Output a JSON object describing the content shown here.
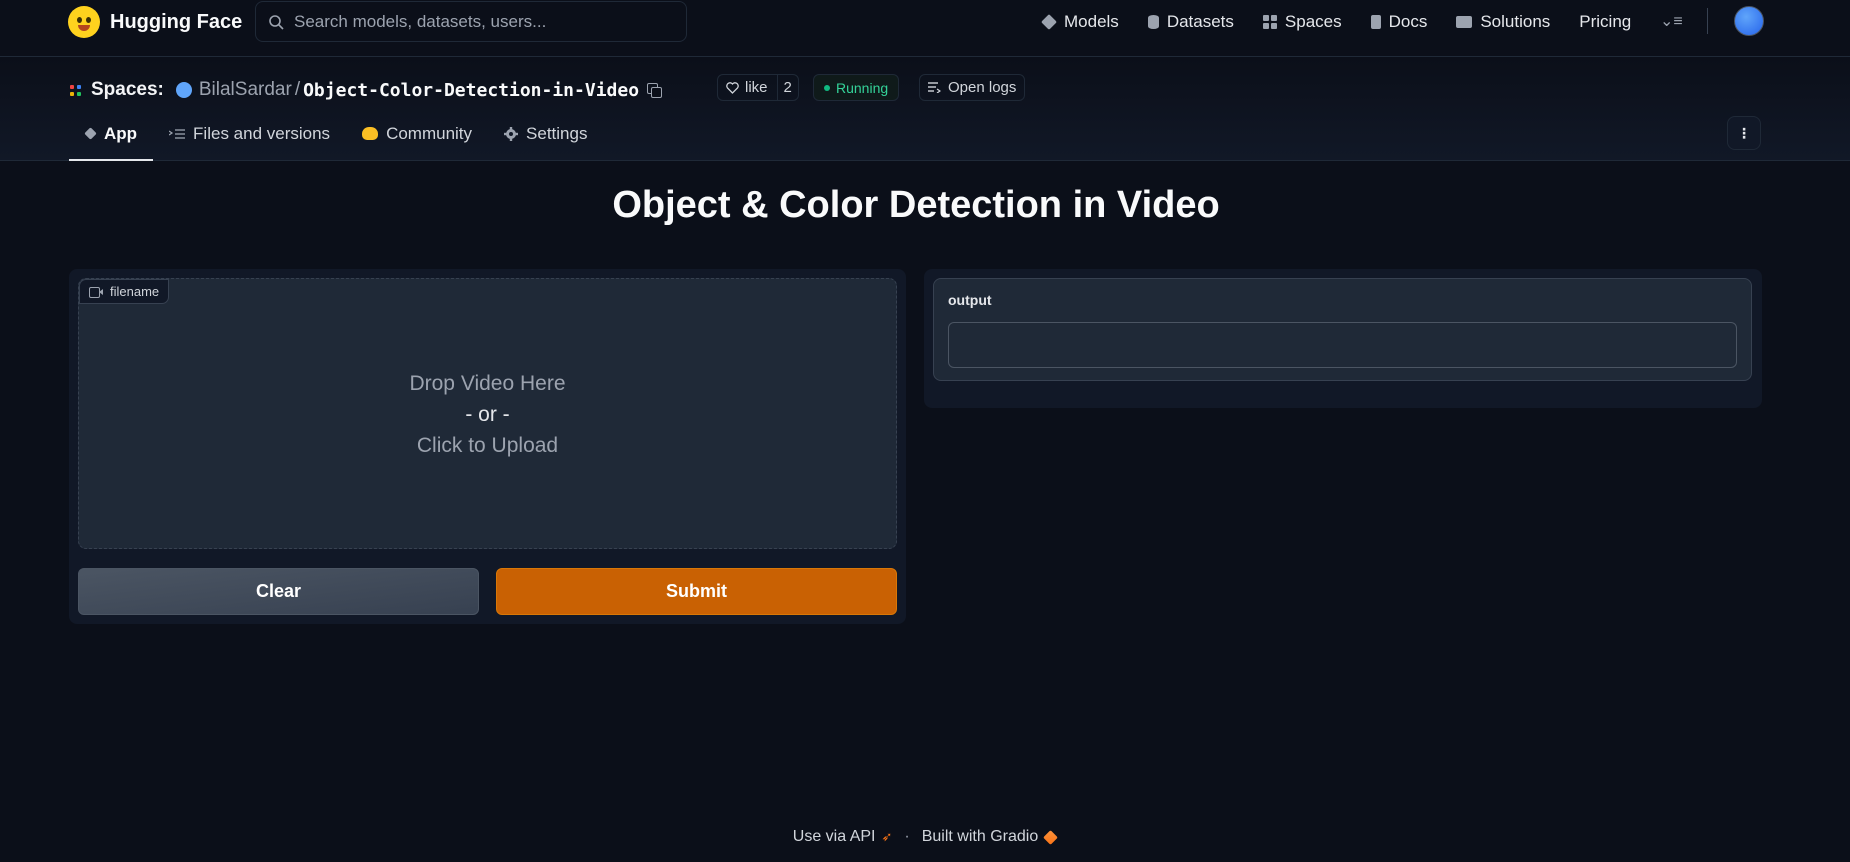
{
  "nav": {
    "brand": "Hugging Face",
    "search_placeholder": "Search models, datasets, users...",
    "links": [
      {
        "label": "Models",
        "icon": "models-cube-icon"
      },
      {
        "label": "Datasets",
        "icon": "database-icon"
      },
      {
        "label": "Spaces",
        "icon": "spaces-grid-icon"
      },
      {
        "label": "Docs",
        "icon": "docs-icon"
      },
      {
        "label": "Solutions",
        "icon": "briefcase-icon"
      },
      {
        "label": "Pricing",
        "icon": ""
      }
    ],
    "menu_icon": "⌄≡"
  },
  "space": {
    "section_label": "Spaces:",
    "owner": "BilalSardar",
    "separator": "/",
    "repo_name": "Object-Color-Detection-in-Video",
    "like_label": "like",
    "like_count": "2",
    "status": "Running",
    "status_color": "#10b981",
    "logs_label": "Open logs",
    "tabs": [
      {
        "label": "App",
        "active": true
      },
      {
        "label": "Files and versions",
        "active": false
      },
      {
        "label": "Community",
        "active": false
      },
      {
        "label": "Settings",
        "active": false
      }
    ],
    "kebab": "⋮"
  },
  "app": {
    "title": "Object & Color Detection in Video",
    "input": {
      "label": "filename",
      "drop_line1": "Drop Video Here",
      "drop_line2": "- or -",
      "drop_line3": "Click to Upload"
    },
    "clear_label": "Clear",
    "submit_label": "Submit",
    "submit_color": "#c96103",
    "output": {
      "label": "output",
      "value": ""
    }
  },
  "footer": {
    "api_label": "Use via API",
    "separator": "·",
    "gradio_label": "Built with Gradio"
  },
  "colors": {
    "background": "#0b0f19",
    "panel": "#111827",
    "block": "#1f2937",
    "brand_yellow": "#ffd21e"
  }
}
